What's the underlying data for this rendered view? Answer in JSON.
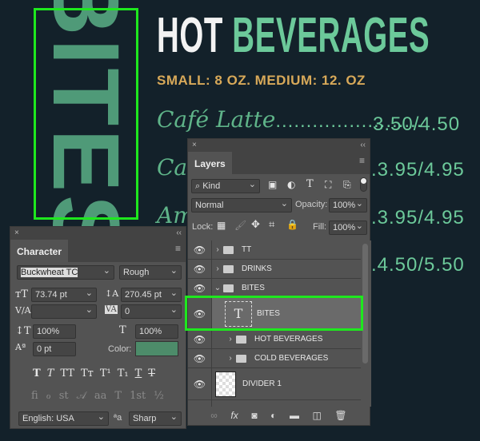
{
  "canvas": {
    "bites_vertical": "BITES",
    "title_white": "HOT",
    "title_green": "BEVERAGES",
    "subtitle": "SMALL: 8 OZ. MEDIUM: 12. OZ",
    "items": [
      {
        "name": "Café Latte",
        "dots": "........................",
        "price": "3.50/4.50"
      },
      {
        "name": "Ca",
        "price": ".3.95/4.95"
      },
      {
        "name": "Am",
        "price": ".3.95/4.95"
      },
      {
        "name": "",
        "price": ".4.50/5.50"
      }
    ],
    "colors": {
      "background": "#13212a",
      "green": "#6cc99a",
      "gold": "#d8a959",
      "selection": "#1ee81e"
    }
  },
  "character": {
    "close": "×",
    "collapse": "‹‹",
    "tab": "Character",
    "menu": "≡",
    "font_family": "Buckwheat TC",
    "font_style": "Rough",
    "font_size": "73.74 pt",
    "leading": "270.45 pt",
    "kerning": "",
    "tracking": "0",
    "vertical_scale": "100%",
    "horizontal_scale": "100%",
    "baseline_shift": "0 pt",
    "color_label": "Color:",
    "color": "#4d8c6a",
    "style_buttons": [
      "T",
      "T",
      "TT",
      "Tт",
      "T¹",
      "T₁",
      "T",
      "T"
    ],
    "opentype_buttons": [
      "fi",
      "ℴ",
      "st",
      "𝒜",
      "aa",
      "T",
      "1st",
      "½"
    ],
    "language": "English: USA",
    "aa_icon": "ªa",
    "antialias": "Sharp"
  },
  "layers": {
    "close": "×",
    "collapse": "‹‹",
    "tab": "Layers",
    "menu": "≡",
    "filter": "Kind",
    "blend_mode": "Normal",
    "opacity_label": "Opacity:",
    "opacity": "100%",
    "lock_label": "Lock:",
    "fill_label": "Fill:",
    "fill": "100%",
    "rows": [
      {
        "name": "TT",
        "type": "group"
      },
      {
        "name": "DRINKS",
        "type": "group"
      },
      {
        "name": "BITES",
        "type": "group-open"
      },
      {
        "name": "BITES",
        "type": "text",
        "selected": true
      },
      {
        "name": "HOT BEVERAGES",
        "type": "group"
      },
      {
        "name": "COLD BEVERAGES",
        "type": "group"
      },
      {
        "name": "DIVIDER 1",
        "type": "pixel"
      }
    ],
    "footer_icons": [
      "link-icon",
      "fx-icon",
      "mask-icon",
      "adjustment-icon",
      "folder-icon",
      "new-layer-icon",
      "trash-icon"
    ]
  }
}
